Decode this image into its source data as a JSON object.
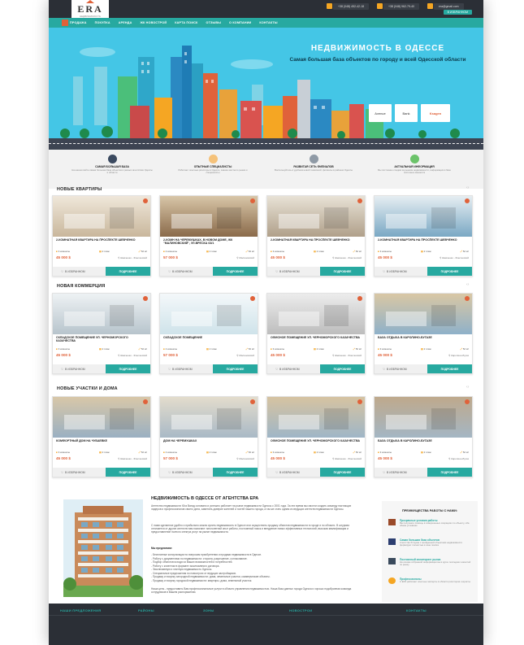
{
  "logo": {
    "text": "ERA",
    "sub": "НЕДВИЖИМОСТЬ"
  },
  "topbar": {
    "phone1": "+38 (048) 452-42-18",
    "phone2": "+38 (048) 962-79-40",
    "email": "era@gmail.com",
    "favorites": "В ИЗБРАННОМ"
  },
  "nav": {
    "items": [
      "ПРОДАЖА",
      "ПОКУПКА",
      "АРЕНДА",
      "ЖК НОВОСТРОЙ",
      "КАРТА ПОИСК",
      "ОТЗЫВЫ",
      "О КОМПАНИИ",
      "КОНТАКТЫ"
    ]
  },
  "hero": {
    "title": "НЕДВИЖИМОСТЬ В ОДЕССЕ",
    "subtitle": "Самая большая база объектов по городу и всей Одесской области",
    "partners": [
      "Avenue",
      "Bank",
      "Ksagen"
    ]
  },
  "features": [
    {
      "title": "САМАЯ БОЛЬШАЯ БАЗА",
      "desc": "На нашем сайте самая большая база объектов в разных агентствах Одессы и области"
    },
    {
      "title": "ОПЫТНЫЕ СПЕЦИАЛИСТЫ",
      "desc": "Работают опытные риэлторы в Одессе, знание местного рынка и специалисты"
    },
    {
      "title": "РАЗВИТАЯ СЕТЬ ФИЛИАЛОВ",
      "desc": "Воспользуйтесь в удобном новой тематикой, филиалы в районах Одессы"
    },
    {
      "title": "АКТУАЛЬНАЯ ИНФОРМАЦИЯ",
      "desc": "Мы постоянно следим за рынком недвижимости, информация в базе постоянно меняется"
    }
  ],
  "sections": {
    "apartments": {
      "title": "НОВЫЕ КВАРТИРЫ",
      "cards": [
        {
          "title": "2-КОМНАТНАЯ КВАРТИРА НА ПРОСПЕКТЕ ШЕВЧЕНКО",
          "rooms": "3 комнаты",
          "floor": "2 этаж",
          "area": "52 м²",
          "price": "45 000 $",
          "loc": "Шевченко - Фонтанский"
        },
        {
          "title": "2-КОМН НА ЧЕРЕМУШКАХ, В НОВОМ ДОМЕ, ЖК \"МАЛИНОВСКИЙ\", УЛ.ВРЕСКА 63/1",
          "rooms": "2 комнаты",
          "floor": "2 этаж",
          "area": "52 м²",
          "price": "57 000 $",
          "loc": "Малиновский"
        },
        {
          "title": "2-КОМНАТНАЯ КВАРТИРА НА ПРОСПЕКТЕ ШЕВЧЕНКО",
          "rooms": "3 комнаты",
          "floor": "2 этаж",
          "area": "52 м²",
          "price": "45 000 $",
          "loc": "Шевченко - Фонтанский"
        },
        {
          "title": "2-КОМНАТНАЯ КВАРТИРА НА ПРОСПЕКТЕ ШЕВЧЕНКО",
          "rooms": "3 комнаты",
          "floor": "2 этаж",
          "area": "52 м²",
          "price": "45 000 $",
          "loc": "Шевченко - Фонтанский"
        }
      ]
    },
    "commercial": {
      "title": "НОВАЯ КОММЕРЦИЯ",
      "cards": [
        {
          "title": "СКЛАДСКОЕ ПОМЕЩЕНИЕ УЛ. ЧЕРНОМОРСКОГО КАЗАЧЕСТВА",
          "rooms": "3 комнаты",
          "floor": "2 этаж",
          "area": "52 м²",
          "price": "45 000 $",
          "loc": "Шевченко - Фонтанский"
        },
        {
          "title": "СКЛАДСКОЕ ПОМЕЩЕНИЕ",
          "rooms": "2 комнаты",
          "floor": "2 этаж",
          "area": "52 м²",
          "price": "57 000 $",
          "loc": "Малиновский"
        },
        {
          "title": "ОФИСНОЕ ПОМЕЩЕНИЕ УЛ. ЧЕРНОМОРСКОГО КАЗАЧЕСТВА",
          "rooms": "3 комнаты",
          "floor": "2 этаж",
          "area": "52 м²",
          "price": "45 000 $",
          "loc": "Шевченко - Фонтанский"
        },
        {
          "title": "БАЗА ОТДЫХА В КАРОЛИНО-БУГАЗЕ",
          "rooms": "3 комнаты",
          "floor": "2 этаж",
          "area": "52 м²",
          "price": "45 000 $",
          "loc": "Каролино-Бугаз"
        }
      ]
    },
    "houses": {
      "title": "НОВЫЕ УЧАСТКИ И ДОМА",
      "cards": [
        {
          "title": "КОМФОРТНЫЙ ДОМ НА ЧУБАЕВКЕ",
          "rooms": "3 комнаты",
          "floor": "2 этаж",
          "area": "52 м²",
          "price": "45 000 $",
          "loc": "Шевченко - Фонтанский"
        },
        {
          "title": "ДОМ НА ЧЕРЕМУШКАХ",
          "rooms": "2 комнаты",
          "floor": "2 этаж",
          "area": "52 м²",
          "price": "57 000 $",
          "loc": "Малиновский"
        },
        {
          "title": "ОФИСНОЕ ПОМЕЩЕНИЕ УЛ. ЧЕРНОМОРСКОГО КАЗАЧЕСТВА",
          "rooms": "3 комнаты",
          "floor": "2 этаж",
          "area": "52 м²",
          "price": "45 000 $",
          "loc": "Шевченко - Фонтанский"
        },
        {
          "title": "БАЗА ОТДЫХА В КАРОЛИНО-БУГАЗЕ",
          "rooms": "3 комнаты",
          "floor": "2 этаж",
          "area": "52 м²",
          "price": "45 000 $",
          "loc": "Каролино-Бугаз"
        }
      ]
    }
  },
  "card_buttons": {
    "fav": "В ИЗБРАННОМ",
    "more": "ПОДРОБНЕЕ"
  },
  "about": {
    "title": "НЕДВИЖИМОСТЬ В ОДЕССЕ ОТ АГЕНТСТВА ЕРА",
    "p1": "Агентство недвижимости Юга Ватад основано и успешно работает на рынке недвижимости Одессы с 2001 года. За эти время мы смогли создать команду настоящих лидеров и профессионалов своего дела, заменить доверие жителей и гостей нашего города, а так же стать одним из ведущих агентств недвижимости Одессы.",
    "p2": "С нами сделанное удобно и прибыльно можно купить недвижимость в Одессе или осуществить продажу объектов недвижимости в городе и по области. В штурмах отличается от других агентств нам помогают: многолетний опыт работы, постоянный поиск и внедрение новых эффективных технологий, высокая квалификация и предоставление полного спектра услуг на рынке недвижимости.",
    "offer_title": "Мы предлагаем:",
    "offers": [
      "- Бесплатные консультации по вопросам приобретения и продажи недвижимости в Одессе.",
      "- Работу с документами по недвижимости: сторона, разрешение, согласование.",
      "- Подбор объектов исходя из Ваших возможностей и потребностей.",
      "- Работу с клиентом в формате эксклюзивного договора.",
      "- Эксклюзивную и элитную недвижимость Одессы.",
      "- Специальные предложения по новострою от ведущих застройщиков.",
      "- Продажу и покупку загородной недвижимости: дома, земельные участки, коммерческие объекты.",
      "- Продажу и покупку городской недвижимости: квартиры, дома, земельный участок."
    ],
    "p3": "Наша цель - предоставить Вам профессиональные услуги в области управления недвижимостью. Наша база данных города Одесса и хорошо подобранная команда сотрудников в Вашем распоряжении."
  },
  "advantages": {
    "title": "ПРЕИМУЩЕСТВА РАБОТЫ С НАМИ:",
    "items": [
      {
        "title": "Прозрачные условия работы",
        "desc": "Вы получаете помощь в совершенных операциях по объекту, оба обеим условиям"
      },
      {
        "title": "Самая большая база объектов",
        "desc": "Агентство Ютрума с пройденной объектами недвижимости формирует полностью в зоне поиска"
      },
      {
        "title": "Постоянный мониторинг рынка",
        "desc": "На основе собранной информации вы в курсе последних новостей по рынку"
      },
      {
        "title": "Профессионалы",
        "desc": "С ЕРА работают опытные эксперты в области риэлторов и юристы"
      }
    ]
  },
  "footer": {
    "cols": [
      "НАШИ ПРЕДЛОЖЕНИЯ",
      "РАЙОНЫ",
      "ЗОНЫ",
      "НОВОСТРОИ",
      "КОНТАКТЫ"
    ]
  },
  "colors": {
    "teal": "#27a9a0",
    "orange": "#e0623a",
    "dark": "#2b2f36",
    "sky": "#44c6e6"
  }
}
